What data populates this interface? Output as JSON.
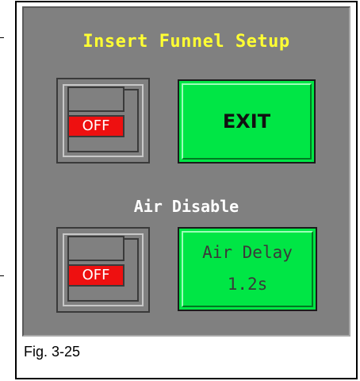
{
  "screen": {
    "title": "Insert Funnel Setup",
    "air_section_label": "Air Disable"
  },
  "funnel_toggle": {
    "state_label": "OFF"
  },
  "exit_button": {
    "label": "EXIT"
  },
  "air_disable_toggle": {
    "state_label": "OFF"
  },
  "air_delay_button": {
    "label": "Air Delay",
    "value": "1.2s"
  },
  "figure": {
    "caption": "Fig. 3-25"
  },
  "colors": {
    "screen_background": "#808080",
    "title_text": "#ffff33",
    "button_green": "#00e645",
    "off_indicator_red": "#ee1010"
  }
}
